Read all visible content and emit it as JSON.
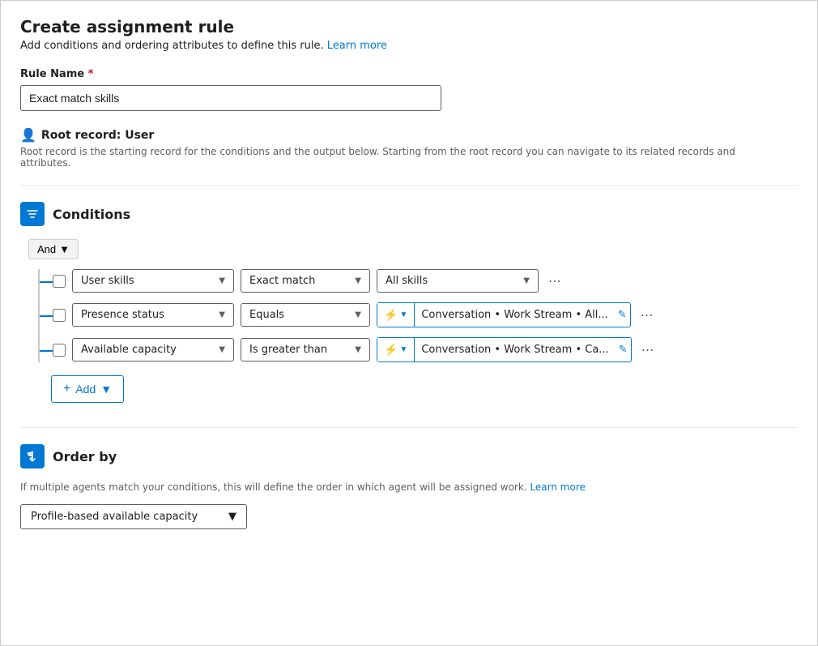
{
  "header": {
    "title": "Create assignment rule",
    "subtitle": "Add conditions and ordering attributes to define this rule.",
    "learn_more_label": "Learn more",
    "learn_more_url": "#"
  },
  "rule_name": {
    "label": "Rule Name",
    "required_marker": "*",
    "value": "Exact match skills"
  },
  "root_record": {
    "label": "Root record: User",
    "description": "Root record is the starting record for the conditions and the output below. Starting from the root record you can navigate to its related records and attributes."
  },
  "conditions": {
    "section_title": "Conditions",
    "and_label": "And",
    "rows": [
      {
        "field": "User skills",
        "operator": "Exact match",
        "value_text": "All skills",
        "value_type": "plain"
      },
      {
        "field": "Presence status",
        "operator": "Equals",
        "value_text": "Conversation • Work Stream • All...",
        "value_type": "dynamic"
      },
      {
        "field": "Available capacity",
        "operator": "Is greater than",
        "value_text": "Conversation • Work Stream • Ca...",
        "value_type": "dynamic"
      }
    ],
    "add_label": "Add"
  },
  "order_by": {
    "section_title": "Order by",
    "description": "If multiple agents match your conditions, this will define the order in which agent will be assigned work.",
    "learn_more_label": "Learn more",
    "learn_more_url": "#",
    "value": "Profile-based available capacity"
  }
}
